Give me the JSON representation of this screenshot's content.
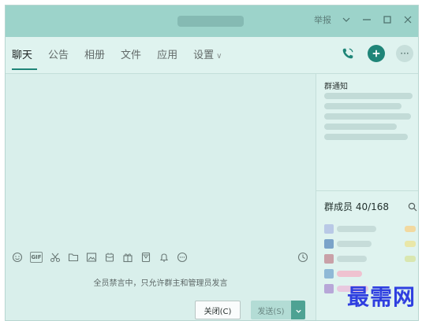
{
  "window": {
    "title": "",
    "report_label": "举报"
  },
  "tabs": [
    {
      "label": "聊天"
    },
    {
      "label": "公告"
    },
    {
      "label": "相册"
    },
    {
      "label": "文件"
    },
    {
      "label": "应用"
    },
    {
      "label": "设置"
    }
  ],
  "tab_icons": {
    "call": "phone-icon",
    "add": "add-icon",
    "more_label": "···"
  },
  "right_panel": {
    "notice_title": "群通知",
    "members_title": "群成员 40/168"
  },
  "toolbar": {
    "gif_label": "GIF",
    "icons": [
      "emoji-icon",
      "gif-icon",
      "scissors-icon",
      "folder-icon",
      "image-icon",
      "redpacket-icon",
      "gift-icon",
      "voice-icon",
      "bell-icon",
      "more-icon",
      "history-icon"
    ]
  },
  "chat": {
    "muted_notice": "全员禁言中，只允许群主和管理员发言"
  },
  "buttons": {
    "close_label": "关闭(C)",
    "send_label": "发送(S)"
  },
  "watermark": {
    "text": "最需网"
  },
  "colors": {
    "titlebar": "#9cd3ca",
    "accent": "#1f8578",
    "background": "#d9efeb"
  }
}
